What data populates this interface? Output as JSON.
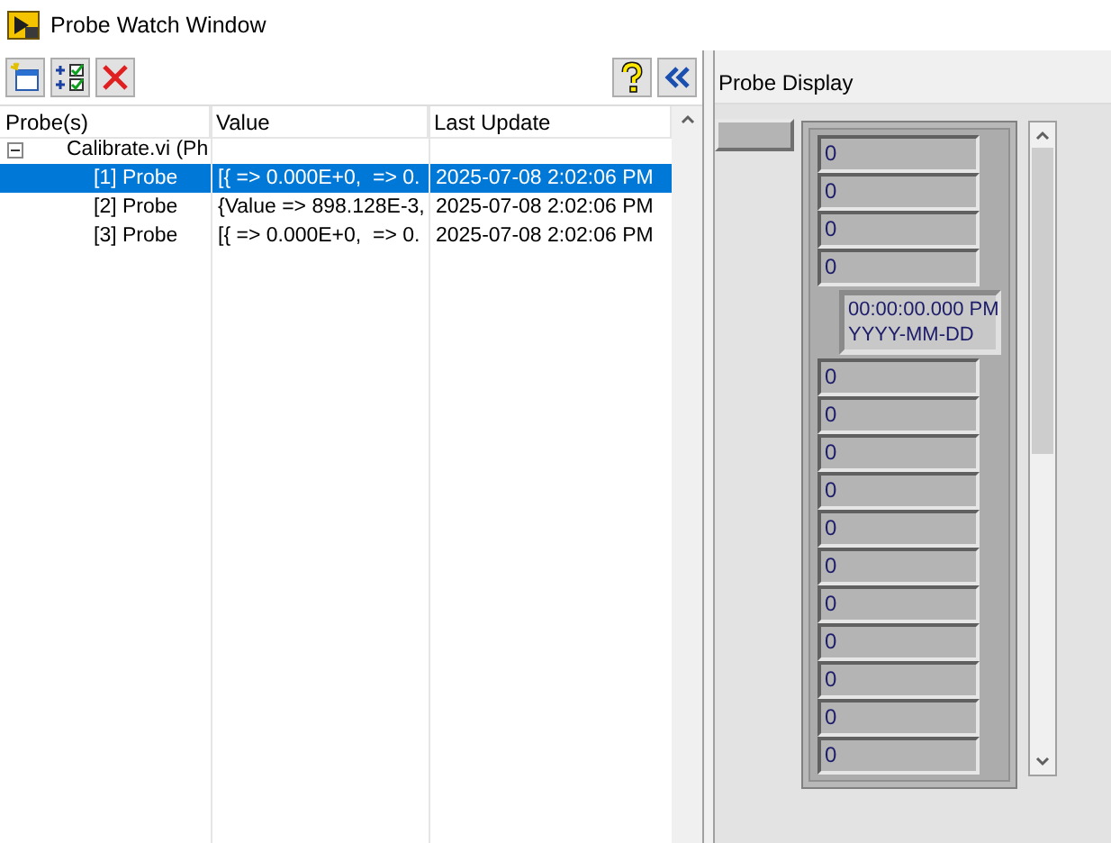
{
  "window": {
    "title": "Probe Watch Window"
  },
  "probes_table": {
    "columns": [
      "Probe(s)",
      "Value",
      "Last Update"
    ],
    "rows": [
      {
        "probe": "Calibrate.vi (Ph",
        "expanded": true,
        "selected": false,
        "children": [
          {
            "probe": "[1] Probe",
            "value": "[{ => 0.000E+0,  => 0.",
            "last_update": "2025-07-08 2:02:06 PM",
            "selected": true
          },
          {
            "probe": "[2] Probe",
            "value": "{Value => 898.128E-3,",
            "last_update": "2025-07-08 2:02:06 PM",
            "selected": false
          },
          {
            "probe": "[3] Probe",
            "value": "[{ => 0.000E+0,  => 0.",
            "last_update": "2025-07-08 2:02:06 PM",
            "selected": false
          }
        ]
      }
    ]
  },
  "probe_display": {
    "title": "Probe Display",
    "array": [
      {
        "kind": "numeric",
        "value": "0"
      },
      {
        "kind": "numeric",
        "value": "0"
      },
      {
        "kind": "numeric",
        "value": "0"
      },
      {
        "kind": "numeric",
        "value": "0"
      },
      {
        "kind": "timestamp",
        "time": "00:00:00.000 PM",
        "date": "YYYY-MM-DD"
      },
      {
        "kind": "numeric",
        "value": "0"
      },
      {
        "kind": "numeric",
        "value": "0"
      },
      {
        "kind": "numeric",
        "value": "0"
      },
      {
        "kind": "numeric",
        "value": "0"
      },
      {
        "kind": "numeric",
        "value": "0"
      },
      {
        "kind": "numeric",
        "value": "0"
      },
      {
        "kind": "numeric",
        "value": "0"
      },
      {
        "kind": "numeric",
        "value": "0"
      },
      {
        "kind": "numeric",
        "value": "0"
      },
      {
        "kind": "numeric",
        "value": "0"
      },
      {
        "kind": "numeric",
        "value": "0"
      }
    ]
  }
}
